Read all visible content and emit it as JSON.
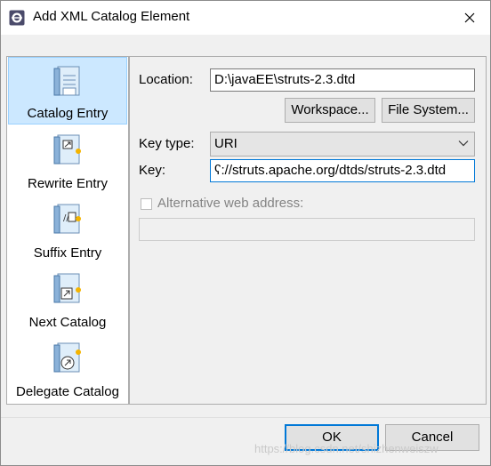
{
  "window": {
    "title": "Add XML Catalog Element"
  },
  "sidebar": {
    "items": [
      {
        "label": "Catalog Entry",
        "icon": "catalog-entry-icon",
        "selected": true
      },
      {
        "label": "Rewrite Entry",
        "icon": "rewrite-entry-icon",
        "selected": false
      },
      {
        "label": "Suffix Entry",
        "icon": "suffix-entry-icon",
        "selected": false
      },
      {
        "label": "Next Catalog",
        "icon": "next-catalog-icon",
        "selected": false
      },
      {
        "label": "Delegate Catalog",
        "icon": "delegate-catalog-icon",
        "selected": false
      }
    ]
  },
  "form": {
    "location_label": "Location:",
    "location_value": "D:\\javaEE\\struts-2.3.dtd",
    "workspace_button": "Workspace...",
    "filesystem_button": "File System...",
    "keytype_label": "Key type:",
    "keytype_value": "URI",
    "key_label": "Key:",
    "key_value": "ʕ://struts.apache.org/dtds/struts-2.3.dtd",
    "alt_web_checkbox_label": "Alternative web address:",
    "alt_web_checked": false,
    "alt_web_value": ""
  },
  "footer": {
    "ok_label": "OK",
    "cancel_label": "Cancel",
    "watermark": "https://blog.csdn.net/shizhenweiszw"
  },
  "colors": {
    "selection": "#cce8ff",
    "focus_border": "#0078d7"
  }
}
